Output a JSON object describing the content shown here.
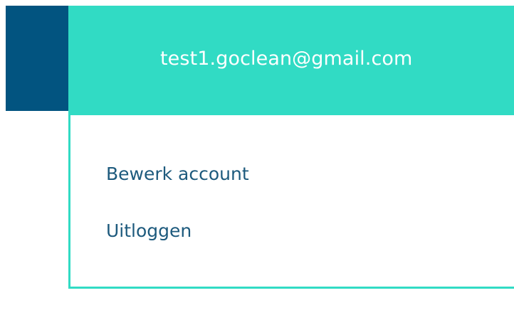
{
  "user": {
    "email": "test1.goclean@gmail.com"
  },
  "menu": {
    "items": [
      {
        "label": "Bewerk account"
      },
      {
        "label": "Uitloggen"
      }
    ]
  },
  "colors": {
    "header_bg": "#31dbc4",
    "nav_block": "#025480",
    "menu_text": "#1d5a7d",
    "email_text": "#ffffff"
  }
}
